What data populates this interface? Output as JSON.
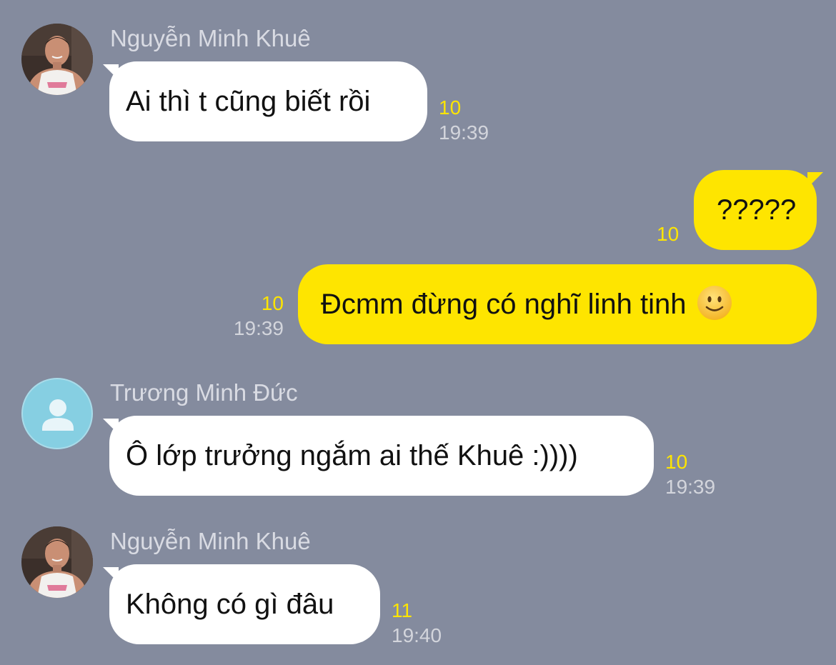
{
  "colors": {
    "background": "#848b9e",
    "incoming_bubble": "#ffffff",
    "outgoing_bubble": "#fee500",
    "unread_count": "#fee500",
    "timestamp": "#d3d5dc",
    "sender_name": "#d9dbe3"
  },
  "messages": [
    {
      "direction": "incoming",
      "sender": "Nguyễn Minh Khuê",
      "avatar": "profile-photo",
      "text": "Ai thì t cũng biết rồi",
      "unread": "10",
      "time": "19:39"
    },
    {
      "direction": "outgoing",
      "text": "?????",
      "unread": "10",
      "time": ""
    },
    {
      "direction": "outgoing",
      "text": "Đcmm đừng có nghĩ linh tinh",
      "emoji": "slightly-smiling-face-icon",
      "unread": "10",
      "time": "19:39"
    },
    {
      "direction": "incoming",
      "sender": "Trương Minh Đức",
      "avatar": "default-person-icon",
      "text": "Ô lớp trưởng ngắm ai thế Khuê :))))",
      "unread": "10",
      "time": "19:39"
    },
    {
      "direction": "incoming",
      "sender": "Nguyễn Minh Khuê",
      "avatar": "profile-photo",
      "text": "Không có gì đâu",
      "unread": "11",
      "time": "19:40"
    }
  ]
}
